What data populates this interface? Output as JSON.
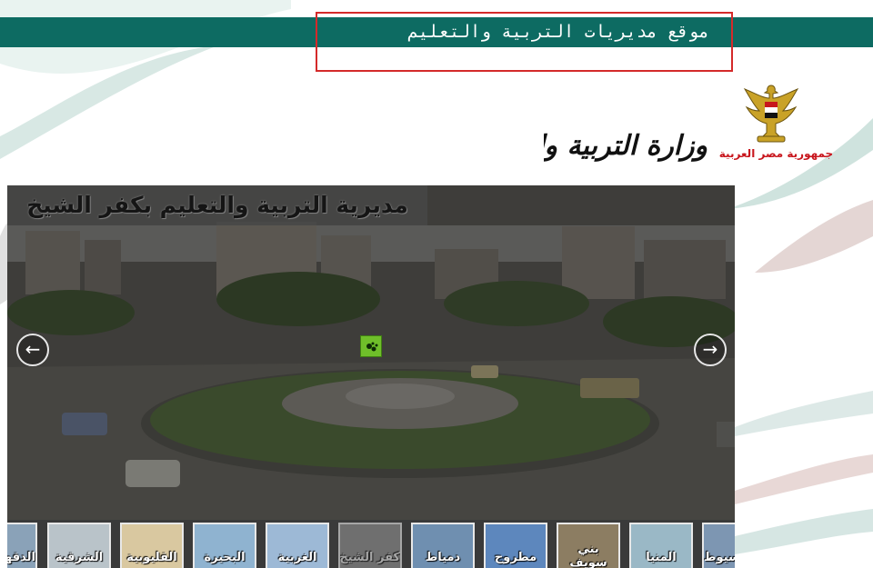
{
  "header": {
    "site_title": "موقع مديريات التربية والتعليم"
  },
  "logos": {
    "ministry": "وزارة التربية والتعليم",
    "republic": "جمهورية مصر العربية"
  },
  "slider": {
    "caption": "مديرية التربية والتعليم بكفر الشيخ",
    "prev_icon": "←",
    "next_icon": "→"
  },
  "thumbnails": [
    {
      "label": "الدقهلية",
      "color": "#8aa2b8"
    },
    {
      "label": "الشرقية",
      "color": "#b9c3c9"
    },
    {
      "label": "القليوبية",
      "color": "#d9c8a0"
    },
    {
      "label": "البحيرة",
      "color": "#8fb3d0"
    },
    {
      "label": "الغربية",
      "color": "#9db9d6"
    },
    {
      "label": "كفر الشيخ",
      "color": "#9b9b9b"
    },
    {
      "label": "دمياط",
      "color": "#6f8fb0"
    },
    {
      "label": "مطروح",
      "color": "#5d87bd"
    },
    {
      "label": "بني سويف",
      "color": "#8c7d62"
    },
    {
      "label": "المنيا",
      "color": "#9ab8c6"
    },
    {
      "label": "أسيوط",
      "color": "#7d96b2"
    }
  ]
}
